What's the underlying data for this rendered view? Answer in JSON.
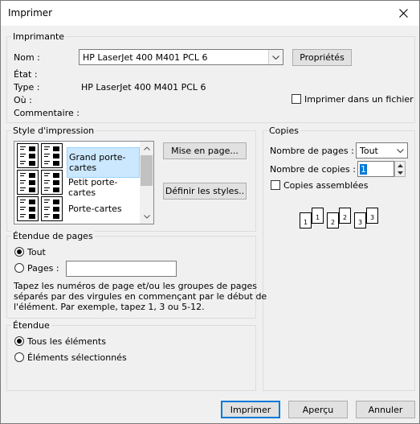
{
  "window": {
    "title": "Imprimer"
  },
  "printer": {
    "group_title": "Imprimante",
    "name_label": "Nom :",
    "name_value": "HP LaserJet 400 M401 PCL 6",
    "properties_button": "Propriétés",
    "status_label": "État :",
    "status_value": "",
    "type_label": "Type :",
    "type_value": "HP LaserJet 400 M401 PCL 6",
    "where_label": "Où :",
    "where_value": "",
    "comment_label": "Commentaire :",
    "comment_value": "",
    "print_to_file_label": "Imprimer dans un fichier",
    "print_to_file_checked": false
  },
  "print_style": {
    "group_title": "Style d'impression",
    "items": [
      {
        "label": "Grand porte-cartes",
        "selected": true
      },
      {
        "label": "Petit porte-cartes",
        "selected": false
      },
      {
        "label": "Porte-cartes",
        "selected": false
      }
    ],
    "page_setup_button": "Mise en page...",
    "define_styles_button": "Définir les styles.."
  },
  "copies": {
    "group_title": "Copies",
    "pages_label": "Nombre de pages :",
    "pages_value": "Tout",
    "copies_label": "Nombre de copies :",
    "copies_value": "1",
    "collate_label": "Copies assemblées",
    "collate_checked": false,
    "collate_pages": [
      "1",
      "1",
      "2",
      "2",
      "3",
      "3"
    ]
  },
  "page_range": {
    "group_title": "Étendue de pages",
    "all_label": "Tout",
    "pages_label": "Pages :",
    "pages_value": "",
    "help_text_1": "Tapez les numéros de page et/ou les groupes de pages",
    "help_text_2": "séparés par des virgules en commençant par le début de",
    "help_text_3": "l'élément. Par exemple, tapez 1, 3 ou 5-12."
  },
  "scope": {
    "group_title": "Étendue",
    "all_items_label": "Tous les éléments",
    "selected_items_label": "Éléments sélectionnés"
  },
  "footer": {
    "print_button": "Imprimer",
    "preview_button": "Aperçu",
    "cancel_button": "Annuler"
  },
  "colors": {
    "accent": "#0078d7",
    "selection": "#cce8ff"
  }
}
